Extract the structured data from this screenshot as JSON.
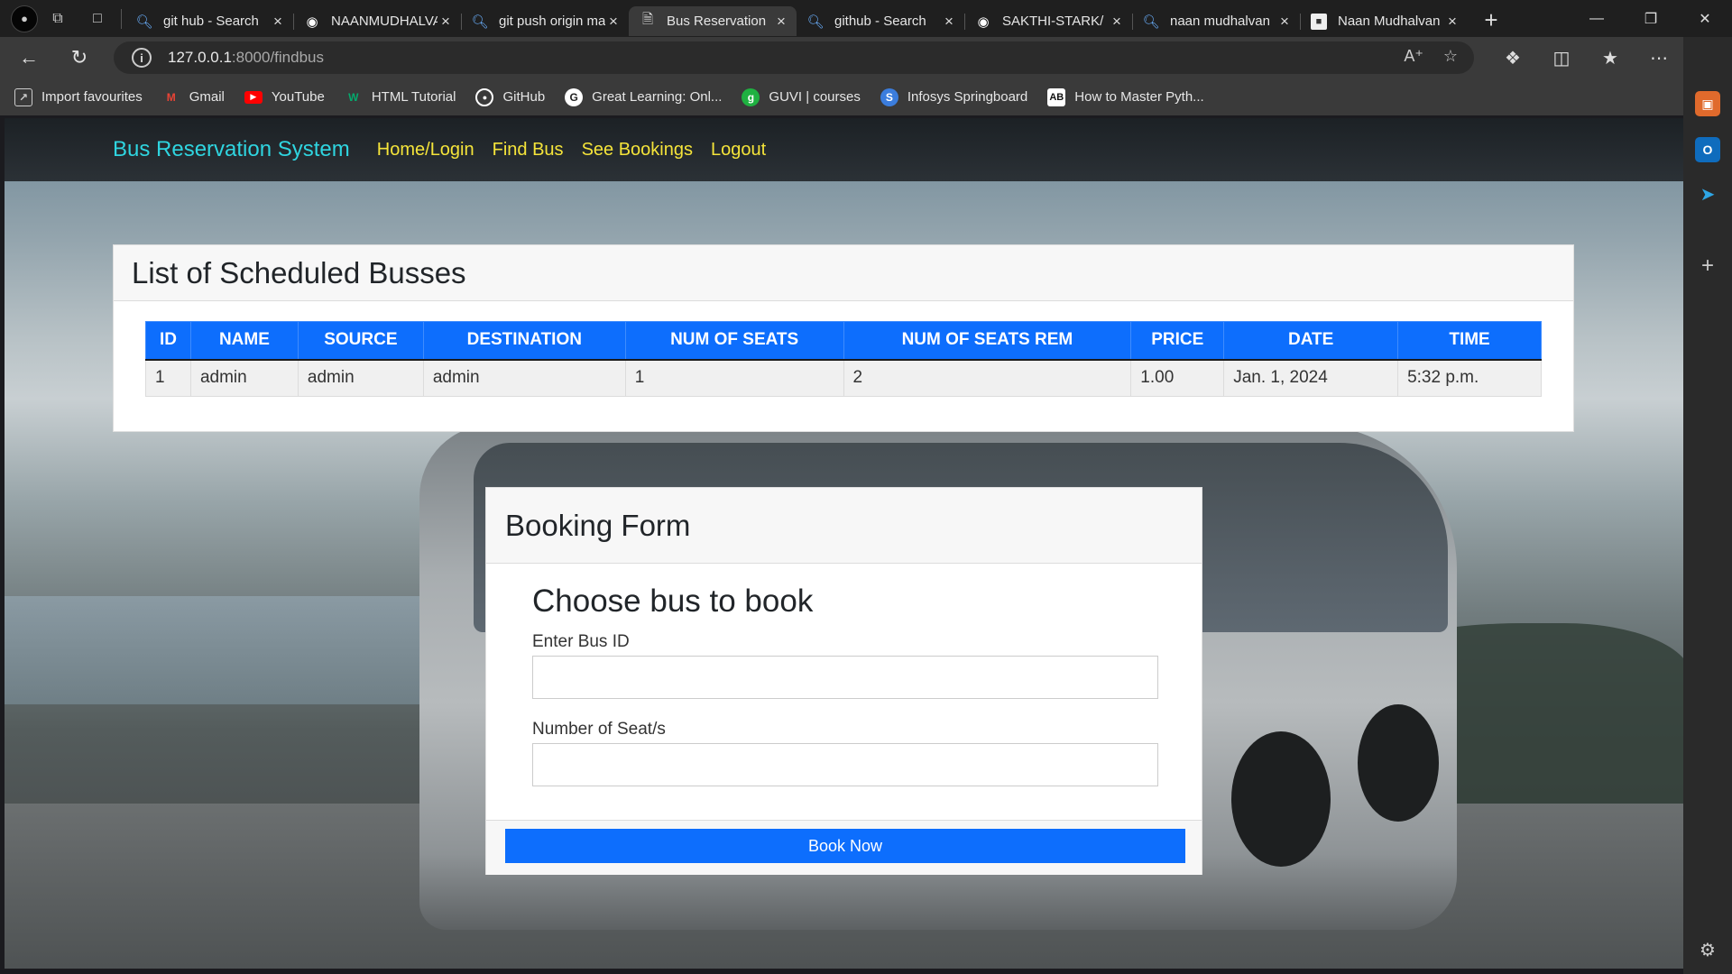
{
  "browser": {
    "tabs": [
      {
        "title": "git hub - Search",
        "icon": "search-icon",
        "active": false
      },
      {
        "title": "NAANMUDHALVAN",
        "icon": "github-icon",
        "active": false
      },
      {
        "title": "git push origin main",
        "icon": "search-icon",
        "active": false
      },
      {
        "title": "Bus Reservation",
        "icon": "page-icon",
        "active": true
      },
      {
        "title": "github - Search",
        "icon": "search-icon",
        "active": false
      },
      {
        "title": "SAKTHI-STARK/",
        "icon": "github-icon",
        "active": false
      },
      {
        "title": "naan mudhalvan",
        "icon": "search-icon",
        "active": false
      },
      {
        "title": "Naan Mudhalvan",
        "icon": "site-icon",
        "active": false
      }
    ],
    "url_host": "127.0.0.1",
    "url_path": ":8000/findbus",
    "favorites": [
      {
        "label": "Import favourites",
        "icon": "import-icon",
        "color": "#cccccc"
      },
      {
        "label": "Gmail",
        "icon": "gmail-icon",
        "color": "#ea4335"
      },
      {
        "label": "YouTube",
        "icon": "youtube-icon",
        "color": "#ff0000"
      },
      {
        "label": "HTML Tutorial",
        "icon": "w3schools-icon",
        "color": "#04aa6d"
      },
      {
        "label": "GitHub",
        "icon": "github-icon",
        "color": "#ffffff"
      },
      {
        "label": "Great Learning: Onl...",
        "icon": "great-learning-icon",
        "color": "#ffffff"
      },
      {
        "label": "GUVI | courses",
        "icon": "guvi-icon",
        "color": "#1fb141"
      },
      {
        "label": "Infosys Springboard",
        "icon": "infosys-icon",
        "color": "#3b7ddd"
      },
      {
        "label": "How to Master Pyth...",
        "icon": "ab-icon",
        "color": "#ffffff"
      }
    ]
  },
  "app": {
    "brand": "Bus Reservation System",
    "nav": [
      "Home/Login",
      "Find Bus",
      "See Bookings",
      "Logout"
    ],
    "colors": {
      "brand": "#2fd5e0",
      "nav_link": "#f5e43a",
      "primary": "#0d6efd"
    }
  },
  "schedule": {
    "title": "List of Scheduled Busses",
    "columns": [
      "ID",
      "NAME",
      "SOURCE",
      "DESTINATION",
      "NUM OF SEATS",
      "NUM OF SEATS REM",
      "PRICE",
      "DATE",
      "TIME"
    ],
    "rows": [
      [
        "1",
        "admin",
        "admin",
        "admin",
        "1",
        "2",
        "1.00",
        "Jan. 1, 2024",
        "5:32 p.m."
      ]
    ]
  },
  "booking": {
    "title": "Booking Form",
    "subtitle": "Choose bus to book",
    "bus_id_label": "Enter Bus ID",
    "bus_id_value": "",
    "seats_label": "Number of Seat/s",
    "seats_value": "",
    "submit_label": "Book Now"
  }
}
